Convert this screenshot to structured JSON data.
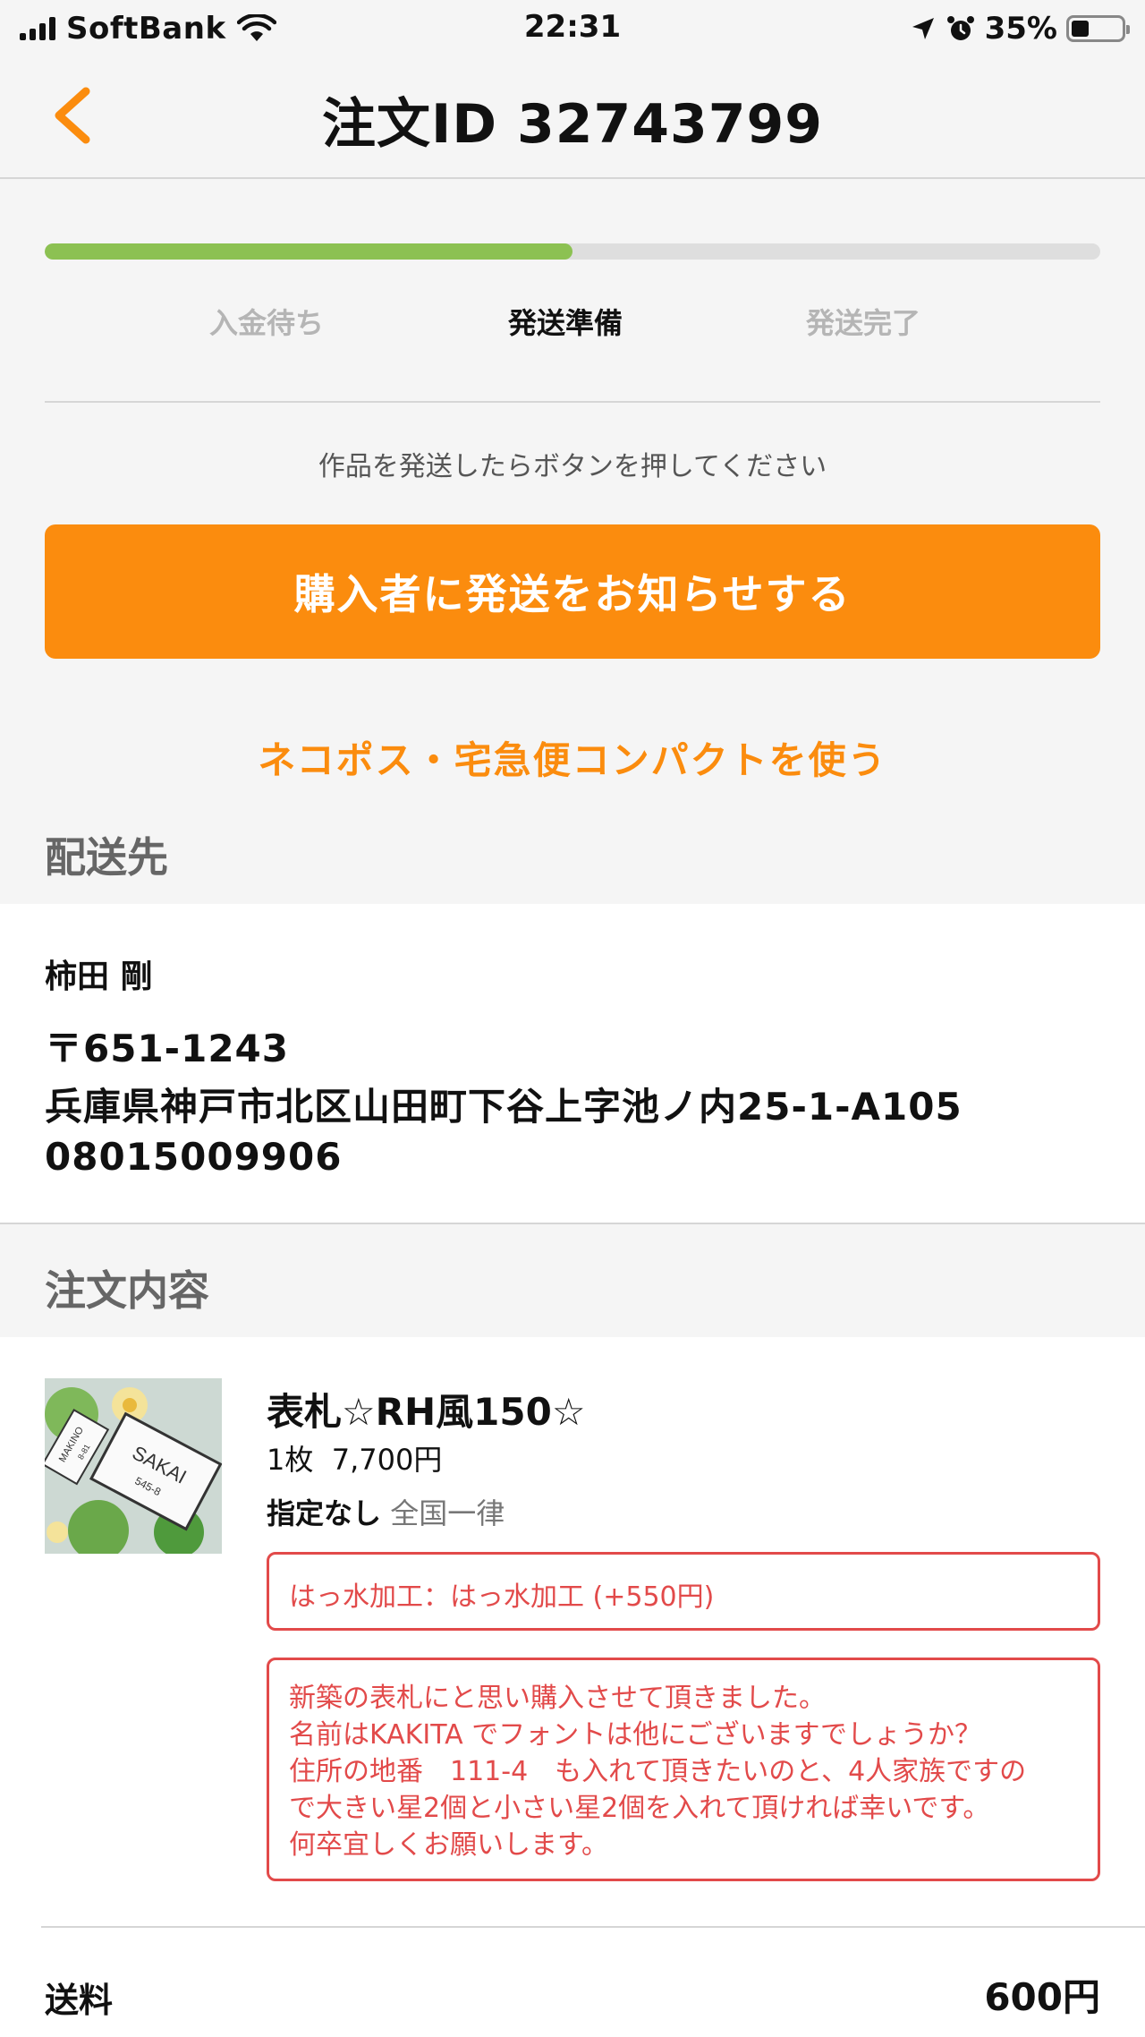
{
  "status_bar": {
    "carrier": "SoftBank",
    "time": "22:31",
    "battery": "35%",
    "battery_level": 0.35
  },
  "nav": {
    "title": "注文ID 32743799"
  },
  "progress": {
    "fraction": 0.5,
    "steps": [
      "入金待ち",
      "発送準備",
      "発送完了"
    ],
    "active_index": 1
  },
  "hint": "作品を発送したらボタンを押してください",
  "primary_button": "購入者に発送をお知らせする",
  "link": "ネコポス・宅急便コンパクトを使う",
  "shipping": {
    "header": "配送先",
    "name": "柿田 剛",
    "postal": "〒651-1243",
    "address": "兵庫県神戸市北区山田町下谷上字池ノ内25-1-A105",
    "phone": "08015009906"
  },
  "order": {
    "header": "注文内容",
    "thumb_texts": [
      "SAKAI",
      "545-8",
      "MAKINO",
      "8-81"
    ],
    "title": "表札☆RH風150☆",
    "quantity": "1枚",
    "price": "7,700円",
    "ship_method": "指定なし",
    "ship_area": "全国一律",
    "option": "はっ水加工：はっ水加工 (+550円)",
    "message_lines": [
      "新築の表札にと思い購入させて頂きました。",
      "名前はKAKITA でフォントは他にございますでしょうか？",
      "住所の地番　111-4　も入れて頂きたいのと、4人家族ですの",
      "で大きい星2個と小さい星2個を入れて頂ければ幸いです。",
      "何卒宜しくお願いします。"
    ],
    "fee_label": "送料",
    "fee_value": "600円"
  },
  "colors": {
    "accent": "#fb8c0e",
    "progress": "#8cc152",
    "alert": "#e24a4a"
  }
}
